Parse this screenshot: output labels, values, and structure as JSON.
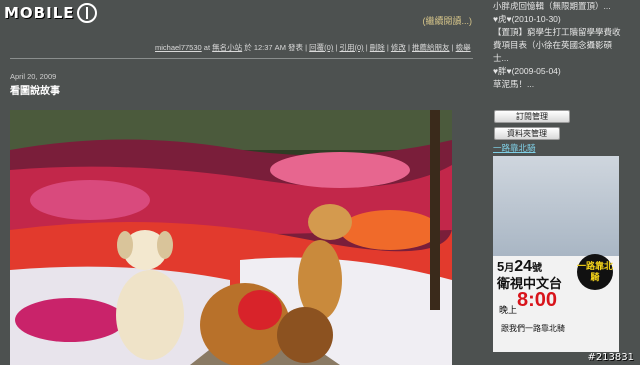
{
  "logo": {
    "text": "MOBILE"
  },
  "post": {
    "continue_link": "(繼續閱讀...)",
    "meta": {
      "author": "michael77530",
      "at": "at",
      "place": "無名小站",
      "time": "於 12:37 AM 發表",
      "links": [
        "回覆(0)",
        "引用(0)",
        "刪除",
        "修改",
        "推薦給朋友",
        "檢舉"
      ]
    },
    "date": "April 20, 2009",
    "title": "看圖說故事"
  },
  "sidebar": {
    "lines": [
      "小胖虎回憶輯（無限期置頂）...",
      "♥虎♥(2010-10-30)",
      "【置頂】窮學生打工贖留學學費收",
      "費項目表（小徐在英國念攝影碩",
      "士...",
      "♥胖♥(2009-05-04)",
      "草泥馬！..."
    ],
    "btn_subscribe": "訂閱管理",
    "btn_folders": "資料夾管理",
    "link_ride": "一路靠北騎",
    "ad": {
      "date_pre": "5",
      "date_mid": "月",
      "date_day": "24",
      "date_post": "號",
      "channel": "衛視中文台",
      "evening": "晚上",
      "time": "8:00",
      "tagline": "跟我們一路靠北騎",
      "logo_text": "一路靠北騎"
    }
  },
  "watermark": "#213831"
}
